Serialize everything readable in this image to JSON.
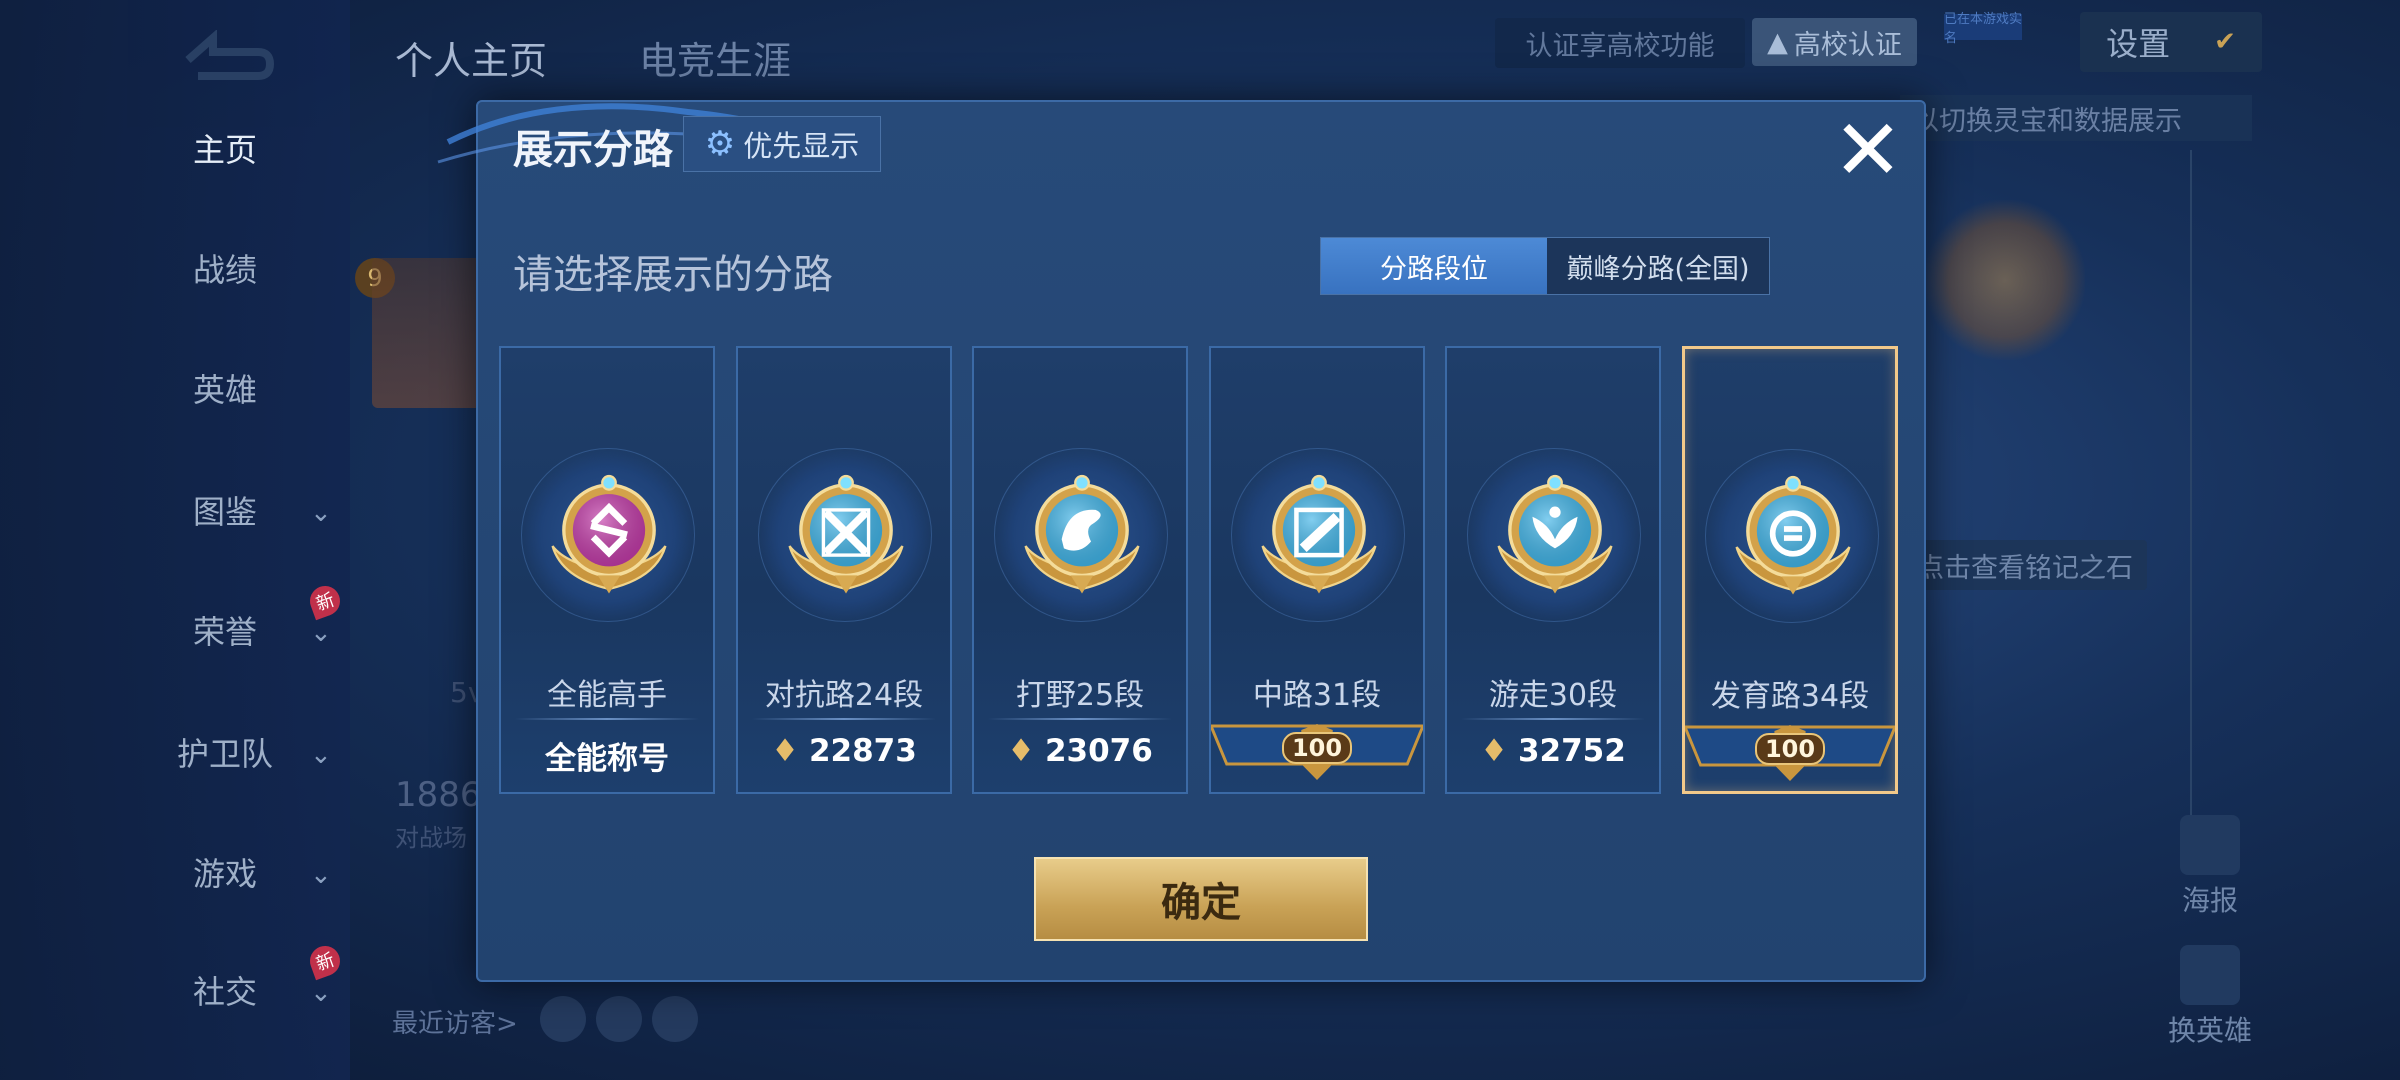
{
  "nav": {
    "items": [
      {
        "label": "主页",
        "active": true,
        "chevron": false,
        "new": false
      },
      {
        "label": "战绩",
        "active": false,
        "chevron": false,
        "new": false
      },
      {
        "label": "英雄",
        "active": false,
        "chevron": false,
        "new": false
      },
      {
        "label": "图鉴",
        "active": false,
        "chevron": true,
        "new": false
      },
      {
        "label": "荣誉",
        "active": false,
        "chevron": true,
        "new": true
      },
      {
        "label": "护卫队",
        "active": false,
        "chevron": true,
        "new": false
      },
      {
        "label": "游戏",
        "active": false,
        "chevron": true,
        "new": false
      },
      {
        "label": "社交",
        "active": false,
        "chevron": true,
        "new": true
      }
    ],
    "new_badge": "新"
  },
  "top_tabs": [
    "个人主页",
    "电竞生涯"
  ],
  "header": {
    "school_hint": "认证享高校功能",
    "school_button": "高校认证",
    "tiny_badge": "已在本游戏实名",
    "settings": "设置"
  },
  "background": {
    "level": "9",
    "hint_top": "以切换灵宝和数据展示",
    "hint_stone": "点击查看铭记之石",
    "score": "1886",
    "score_sub": "对战场",
    "mode": "5v",
    "recent_visitors": "最近访客>",
    "poster": "海报",
    "switch_hero": "换英雄"
  },
  "dialog": {
    "title": "展示分路",
    "priority_button": "优先显示",
    "prompt": "请选择展示的分路",
    "tabs": {
      "active": "分路段位",
      "inactive": "巅峰分路(全国)"
    },
    "confirm": "确定",
    "lanes": [
      {
        "name": "全能高手",
        "value": "全能称号",
        "value_type": "text",
        "emblem": "all-round-icon",
        "color": "#c23aa8",
        "selected": false
      },
      {
        "name": "对抗路24段",
        "value": "22873",
        "value_type": "points",
        "emblem": "clash-lane-icon",
        "color": "#3fb4e8",
        "selected": false
      },
      {
        "name": "打野25段",
        "value": "23076",
        "value_type": "points",
        "emblem": "jungle-icon",
        "color": "#3fb4e8",
        "selected": false
      },
      {
        "name": "中路31段",
        "value": "100",
        "value_type": "banner",
        "emblem": "mid-lane-icon",
        "color": "#3fb4e8",
        "selected": false
      },
      {
        "name": "游走30段",
        "value": "32752",
        "value_type": "points",
        "emblem": "roam-icon",
        "color": "#3fb4e8",
        "selected": false
      },
      {
        "name": "发育路34段",
        "value": "100",
        "value_type": "banner",
        "emblem": "farm-lane-icon",
        "color": "#3fb4e8",
        "selected": true
      }
    ]
  }
}
